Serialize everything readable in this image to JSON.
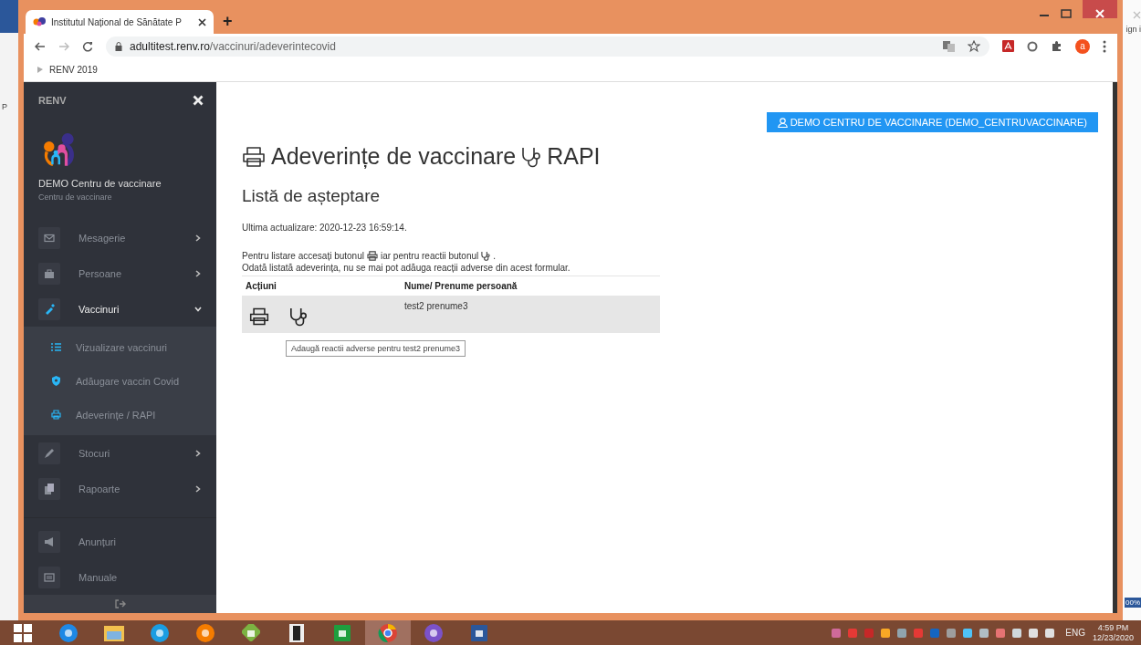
{
  "desktop": {
    "edge_texts": [
      "P",
      "ign i",
      "00%"
    ]
  },
  "browser": {
    "tabs": [
      {
        "title": "Institutul Național de Sănătate P",
        "selected": true
      }
    ],
    "new_tab": "+",
    "url_host": "adultitest.renv.ro",
    "url_path": "/vaccinuri/adeverintecovid",
    "profile_initial": "a",
    "bookmarks": [
      "RENV 2019"
    ]
  },
  "sidebar": {
    "brand": "RENV",
    "org_name": "DEMO Centru de vaccinare",
    "org_role": "Centru de vaccinare",
    "items": [
      {
        "label": "Mesagerie",
        "kind": "menu",
        "expanded": false
      },
      {
        "label": "Persoane",
        "kind": "menu",
        "expanded": false
      },
      {
        "label": "Vaccinuri",
        "kind": "menu",
        "expanded": true,
        "children": [
          {
            "label": "Vizualizare vaccinuri"
          },
          {
            "label": "Adăugare vaccin Covid"
          },
          {
            "label": "Adeverințe / RAPI"
          }
        ]
      },
      {
        "label": "Stocuri",
        "kind": "menu",
        "expanded": false
      },
      {
        "label": "Rapoarte",
        "kind": "menu",
        "expanded": false
      },
      {
        "label": "Anunțuri",
        "kind": "link"
      },
      {
        "label": "Manuale",
        "kind": "link"
      }
    ]
  },
  "main": {
    "user_button": "DEMO CENTRU DE VACCINARE (DEMO_CENTRUVACCINARE)",
    "title": "Adeverințe de vaccinare",
    "title_suffix": "RAPI",
    "subtitle": "Listă de așteptare",
    "last_update": "Ultima actualizare: 2020-12-23 16:59:14.",
    "hint_parts": [
      "Pentru listare accesați butonul",
      "iar pentru reactii butonul",
      "."
    ],
    "notice": "Odată listată adeverința, nu se mai pot adăuga reacții adverse din acest formular.",
    "table": {
      "columns": [
        "Acțiuni",
        "Nume/ Prenume persoană"
      ],
      "rows": [
        {
          "name": "test2 prenume3",
          "hovered": true
        }
      ]
    },
    "tooltip": "Adaugă reactii adverse pentru test2 prenume3"
  },
  "taskbar": {
    "apps": [
      {
        "kind": "windows",
        "selected": false
      },
      {
        "kind": "ie",
        "selected": false
      },
      {
        "kind": "folder",
        "selected": false
      },
      {
        "kind": "edge",
        "selected": false
      },
      {
        "kind": "firefox",
        "selected": false
      },
      {
        "kind": "help",
        "selected": false
      },
      {
        "kind": "film",
        "selected": false
      },
      {
        "kind": "store",
        "selected": false
      },
      {
        "kind": "chrome",
        "selected": true
      },
      {
        "kind": "shield",
        "selected": false
      },
      {
        "kind": "word",
        "selected": false
      }
    ],
    "language": "ENG",
    "time": "4:59 PM",
    "date": "12/23/2020"
  }
}
